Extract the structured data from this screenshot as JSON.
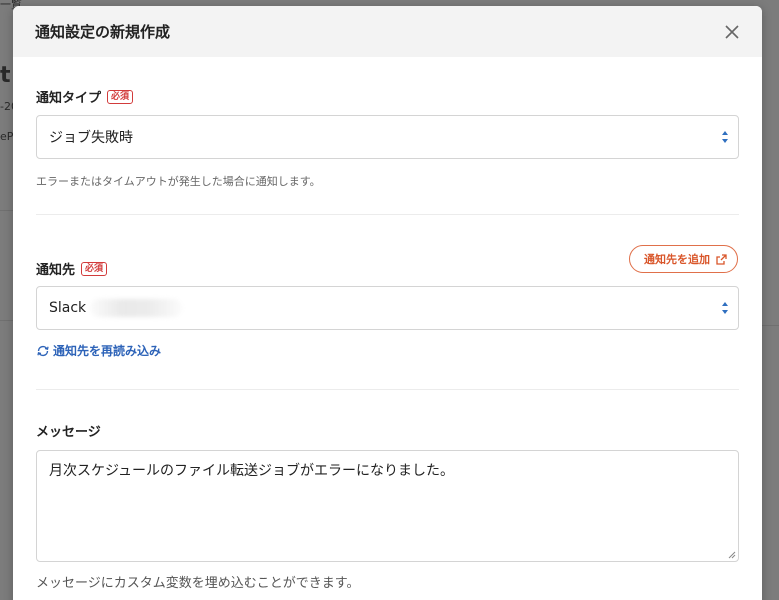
{
  "background": {
    "fragments": [
      "一覧",
      "t",
      "-20",
      "eP"
    ]
  },
  "modal": {
    "title": "通知設定の新規作成",
    "close_icon": "close-icon"
  },
  "notification_type": {
    "label": "通知タイプ",
    "required": "必須",
    "selected": "ジョブ失敗時",
    "help": "エラーまたはタイムアウトが発生した場合に通知します。"
  },
  "destination": {
    "label": "通知先",
    "required": "必須",
    "add_button": "通知先を追加",
    "selected": "Slack",
    "reload": "通知先を再読み込み"
  },
  "message": {
    "label": "メッセージ",
    "value": "月次スケジュールのファイル転送ジョブがエラーになりました。",
    "help": "メッセージにカスタム変数を埋め込むことができます。"
  },
  "colors": {
    "accent_orange": "#d9562a",
    "required_red": "#d23b3b",
    "link_blue": "#2d63b8",
    "select_arrow_blue": "#2f6fc0"
  }
}
